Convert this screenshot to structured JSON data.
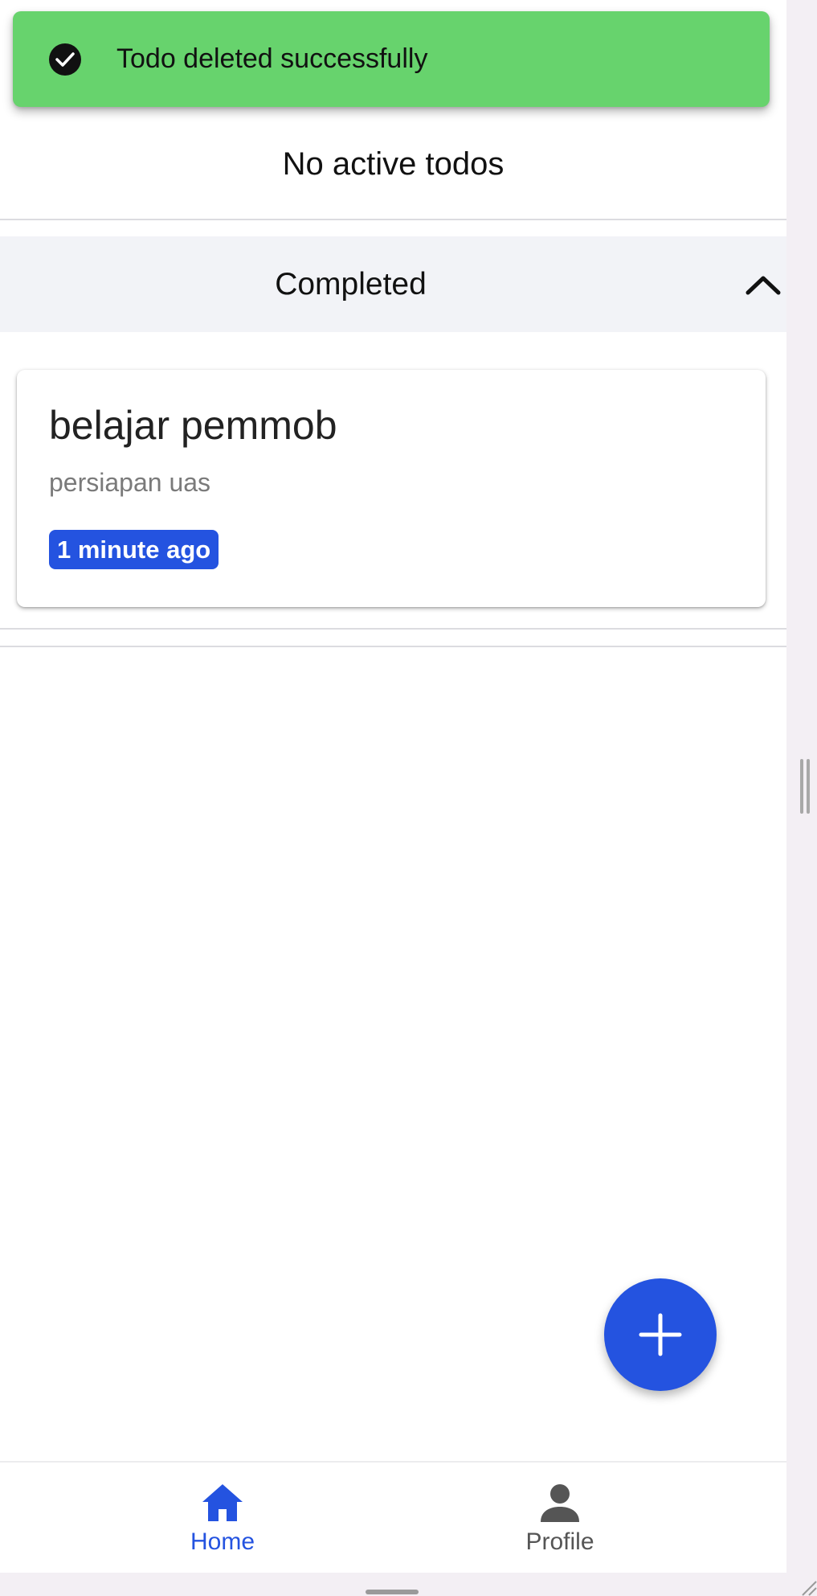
{
  "toast": {
    "message": "Todo deleted successfully",
    "icon": "check-circle-icon",
    "background": "#67d36d"
  },
  "active": {
    "empty_text": "No active todos"
  },
  "completed_section": {
    "title": "Completed",
    "toggle_icon": "chevron-up-icon",
    "expanded": true
  },
  "completed_todos": [
    {
      "title": "belajar pemmob",
      "description": "persiapan uas",
      "time_badge": "1 minute ago"
    }
  ],
  "fab": {
    "icon": "plus-icon"
  },
  "bottom_nav": {
    "items": [
      {
        "label": "Home",
        "icon": "home-icon",
        "active": true
      },
      {
        "label": "Profile",
        "icon": "person-icon",
        "active": false
      }
    ]
  },
  "colors": {
    "accent": "#2453e0",
    "inactive": "#555555",
    "toast": "#67d36d"
  }
}
